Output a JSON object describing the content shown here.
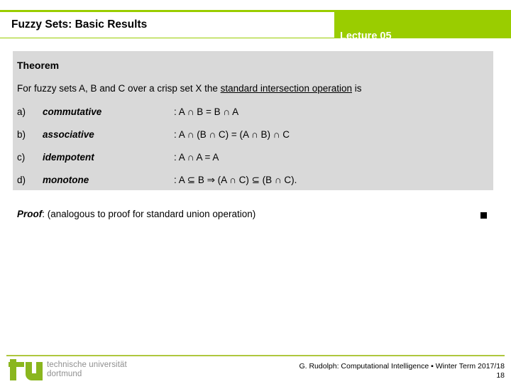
{
  "header": {
    "title": "Fuzzy Sets: Basic Results",
    "lecture": "Lecture 05",
    "accent_color": "#9ACD00",
    "title_box_color": "#ffffff"
  },
  "theorem": {
    "heading": "Theorem",
    "statement_pre": "For fuzzy sets A, B and C over a crisp set X the ",
    "statement_underlined": "standard intersection operation",
    "statement_post": " is",
    "panel_color": "#d9d9d9",
    "properties": [
      {
        "marker": "a)",
        "name": "commutative",
        "formula": ": A ∩ B = B ∩ A"
      },
      {
        "marker": "b)",
        "name": "associative",
        "formula": ": A ∩ (B ∩ C) = (A ∩ B) ∩ C"
      },
      {
        "marker": "c)",
        "name": "idempotent",
        "formula": ": A ∩ A = A"
      },
      {
        "marker": "d)",
        "name": "monotone",
        "formula": ": A ⊆ B  ⇒  (A ∩ C) ⊆ (B ∩ C)."
      }
    ]
  },
  "proof": {
    "label": "Proof",
    "separator": ":  ",
    "text": "(analogous to proof for standard union operation)",
    "qed_marker": "qed-square"
  },
  "footer": {
    "logo_mark": "tu",
    "logo_line1": "technische universität",
    "logo_line2": "dortmund",
    "logo_green": "#8ab61e",
    "logo_gray": "#8f8f8f",
    "credit": "G. Rudolph: Computational Intelligence ▪ Winter Term 2017/18",
    "page_number": "18",
    "rule_color": "#aec73e"
  }
}
